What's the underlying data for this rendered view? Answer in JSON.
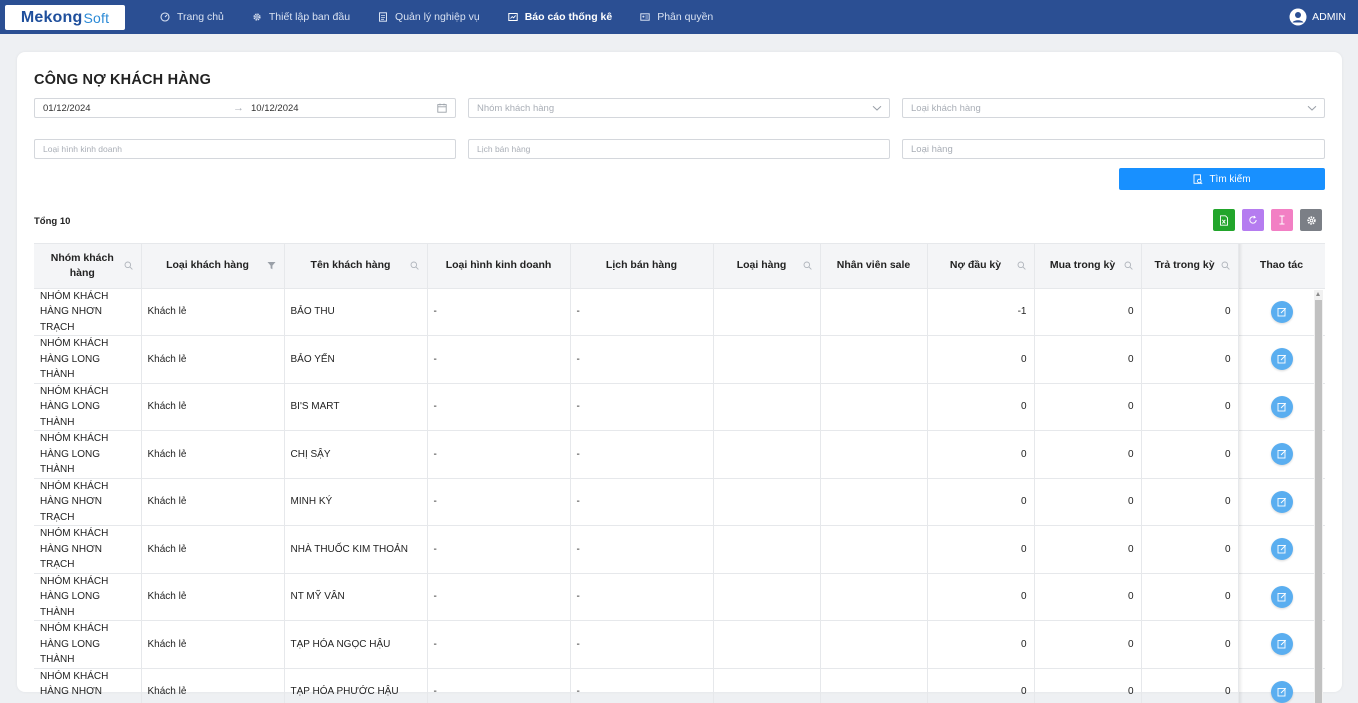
{
  "brand": {
    "logo_part1": "Mekong",
    "logo_part2": "Soft"
  },
  "nav": [
    {
      "label": "Trang chủ",
      "icon": "dashboard-icon"
    },
    {
      "label": "Thiết lập ban đầu",
      "icon": "gear-icon"
    },
    {
      "label": "Quản lý nghiệp vụ",
      "icon": "document-icon"
    },
    {
      "label": "Báo cáo thống kê",
      "icon": "report-icon",
      "active": true
    },
    {
      "label": "Phân quyền",
      "icon": "id-card-icon"
    }
  ],
  "user": {
    "name": "ADMIN",
    "icon": "user-circle-icon"
  },
  "page": {
    "title": "CÔNG NỢ KHÁCH HÀNG"
  },
  "filters": {
    "date_from": "01/12/2024",
    "date_to": "10/12/2024",
    "customer_group_placeholder": "Nhóm khách hàng",
    "customer_type_placeholder": "Loại khách hàng",
    "business_type_placeholder": "Loại hình kinh doanh",
    "sales_schedule_placeholder": "Lịch bán hàng",
    "goods_type_placeholder": "Loại hàng",
    "search_label": "Tìm kiếm"
  },
  "summary": {
    "total_label": "Tổng 10"
  },
  "toolbar": {
    "buttons": [
      {
        "name": "excel-export-button",
        "icon": "excel-icon",
        "color": "#22a52b"
      },
      {
        "name": "refresh-button",
        "icon": "refresh-icon",
        "color": "#b57cf0"
      },
      {
        "name": "column-width-button",
        "icon": "text-cursor-icon",
        "color": "#f27fc4"
      },
      {
        "name": "settings-button",
        "icon": "gear-icon",
        "color": "#7b7f86"
      }
    ]
  },
  "table": {
    "columns": [
      "Nhóm khách hàng",
      "Loại khách hàng",
      "Tên khách hàng",
      "Loại hình kinh doanh",
      "Lịch bán hàng",
      "Loại hàng",
      "Nhân viên sale",
      "Nợ đầu kỳ",
      "Mua trong kỳ",
      "Trả trong kỳ",
      "Thao tác"
    ],
    "rows": [
      {
        "group": "NHÓM KHÁCH HÀNG NHƠN TRẠCH",
        "type": "Khách lẻ",
        "name": "BẢO THU",
        "business": "-",
        "schedule": "-",
        "goods": "",
        "sale": "",
        "opening": "-1",
        "purchase": "0",
        "paid": "0"
      },
      {
        "group": "NHÓM KHÁCH HÀNG LONG THÀNH",
        "type": "Khách lẻ",
        "name": "BẢO YẾN",
        "business": "-",
        "schedule": "-",
        "goods": "",
        "sale": "",
        "opening": "0",
        "purchase": "0",
        "paid": "0"
      },
      {
        "group": "NHÓM KHÁCH HÀNG LONG THÀNH",
        "type": "Khách lẻ",
        "name": "BI'S MART",
        "business": "-",
        "schedule": "-",
        "goods": "",
        "sale": "",
        "opening": "0",
        "purchase": "0",
        "paid": "0"
      },
      {
        "group": "NHÓM KHÁCH HÀNG LONG THÀNH",
        "type": "Khách lẻ",
        "name": "CHỊ SẬY",
        "business": "-",
        "schedule": "-",
        "goods": "",
        "sale": "",
        "opening": "0",
        "purchase": "0",
        "paid": "0"
      },
      {
        "group": "NHÓM KHÁCH HÀNG NHƠN TRẠCH",
        "type": "Khách lẻ",
        "name": "MINH KÝ",
        "business": "-",
        "schedule": "-",
        "goods": "",
        "sale": "",
        "opening": "0",
        "purchase": "0",
        "paid": "0"
      },
      {
        "group": "NHÓM KHÁCH HÀNG NHƠN TRẠCH",
        "type": "Khách lẻ",
        "name": "NHÀ THUỐC KIM THOẢN",
        "business": "-",
        "schedule": "-",
        "goods": "",
        "sale": "",
        "opening": "0",
        "purchase": "0",
        "paid": "0"
      },
      {
        "group": "NHÓM KHÁCH HÀNG LONG THÀNH",
        "type": "Khách lẻ",
        "name": "NT MỸ VÂN",
        "business": "-",
        "schedule": "-",
        "goods": "",
        "sale": "",
        "opening": "0",
        "purchase": "0",
        "paid": "0"
      },
      {
        "group": "NHÓM KHÁCH HÀNG LONG THÀNH",
        "type": "Khách lẻ",
        "name": "TẠP HÓA NGỌC HẬU",
        "business": "-",
        "schedule": "-",
        "goods": "",
        "sale": "",
        "opening": "0",
        "purchase": "0",
        "paid": "0"
      },
      {
        "group": "NHÓM KHÁCH HÀNG NHƠN TRẠCH",
        "type": "Khách lẻ",
        "name": "TẠP HÓA PHƯỚC HẬU",
        "business": "-",
        "schedule": "-",
        "goods": "",
        "sale": "",
        "opening": "0",
        "purchase": "0",
        "paid": "0"
      }
    ]
  }
}
